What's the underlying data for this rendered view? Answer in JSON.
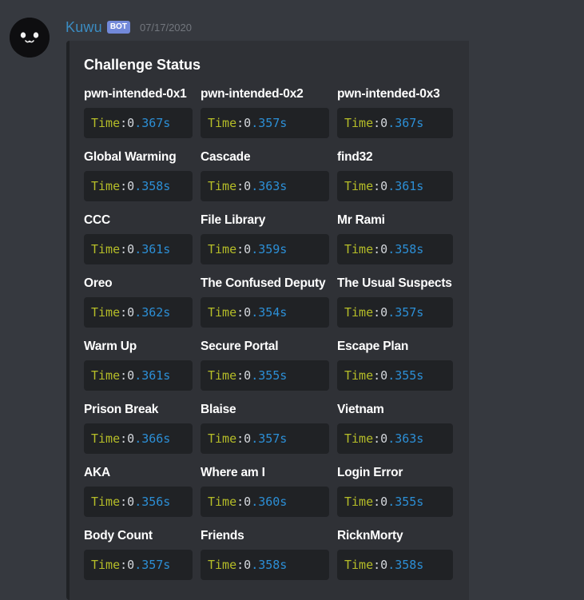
{
  "message": {
    "username": "Kuwu",
    "bot_tag": "BOT",
    "timestamp": "07/17/2020"
  },
  "embed": {
    "title": "Challenge Status",
    "time_label": "Time",
    "fields": [
      {
        "name": "pwn-intended-0x1",
        "int": "0",
        "frac": ".367s"
      },
      {
        "name": "pwn-intended-0x2",
        "int": "0",
        "frac": ".357s"
      },
      {
        "name": "pwn-intended-0x3",
        "int": "0",
        "frac": ".367s"
      },
      {
        "name": "Global Warming",
        "int": "0",
        "frac": ".358s"
      },
      {
        "name": "Cascade",
        "int": "0",
        "frac": ".363s"
      },
      {
        "name": "find32",
        "int": "0",
        "frac": ".361s"
      },
      {
        "name": "CCC",
        "int": "0",
        "frac": ".361s"
      },
      {
        "name": "File Library",
        "int": "0",
        "frac": ".359s"
      },
      {
        "name": "Mr Rami",
        "int": "0",
        "frac": ".358s"
      },
      {
        "name": "Oreo",
        "int": "0",
        "frac": ".362s"
      },
      {
        "name": "The Confused Deputy",
        "int": "0",
        "frac": ".354s"
      },
      {
        "name": "The Usual Suspects",
        "int": "0",
        "frac": ".357s"
      },
      {
        "name": "Warm Up",
        "int": "0",
        "frac": ".361s"
      },
      {
        "name": "Secure Portal",
        "int": "0",
        "frac": ".355s"
      },
      {
        "name": "Escape Plan",
        "int": "0",
        "frac": ".355s"
      },
      {
        "name": "Prison Break",
        "int": "0",
        "frac": ".366s"
      },
      {
        "name": "Blaise",
        "int": "0",
        "frac": ".357s"
      },
      {
        "name": "Vietnam",
        "int": "0",
        "frac": ".363s"
      },
      {
        "name": "AKA",
        "int": "0",
        "frac": ".356s"
      },
      {
        "name": "Where am I",
        "int": "0",
        "frac": ".360s"
      },
      {
        "name": "Login Error",
        "int": "0",
        "frac": ".355s"
      },
      {
        "name": "Body Count",
        "int": "0",
        "frac": ".357s"
      },
      {
        "name": "Friends",
        "int": "0",
        "frac": ".358s"
      },
      {
        "name": "RicknMorty",
        "int": "0",
        "frac": ".358s"
      }
    ]
  },
  "colors": {
    "background": "#36393f",
    "embed_background": "#2f3136",
    "code_background": "#202225",
    "username": "#3b8cc2",
    "bot_tag": "#7289da",
    "time_keyword": "#b5bd28",
    "number": "#2c8fd6"
  },
  "icons": {
    "avatar": "black-cat-face-icon"
  }
}
